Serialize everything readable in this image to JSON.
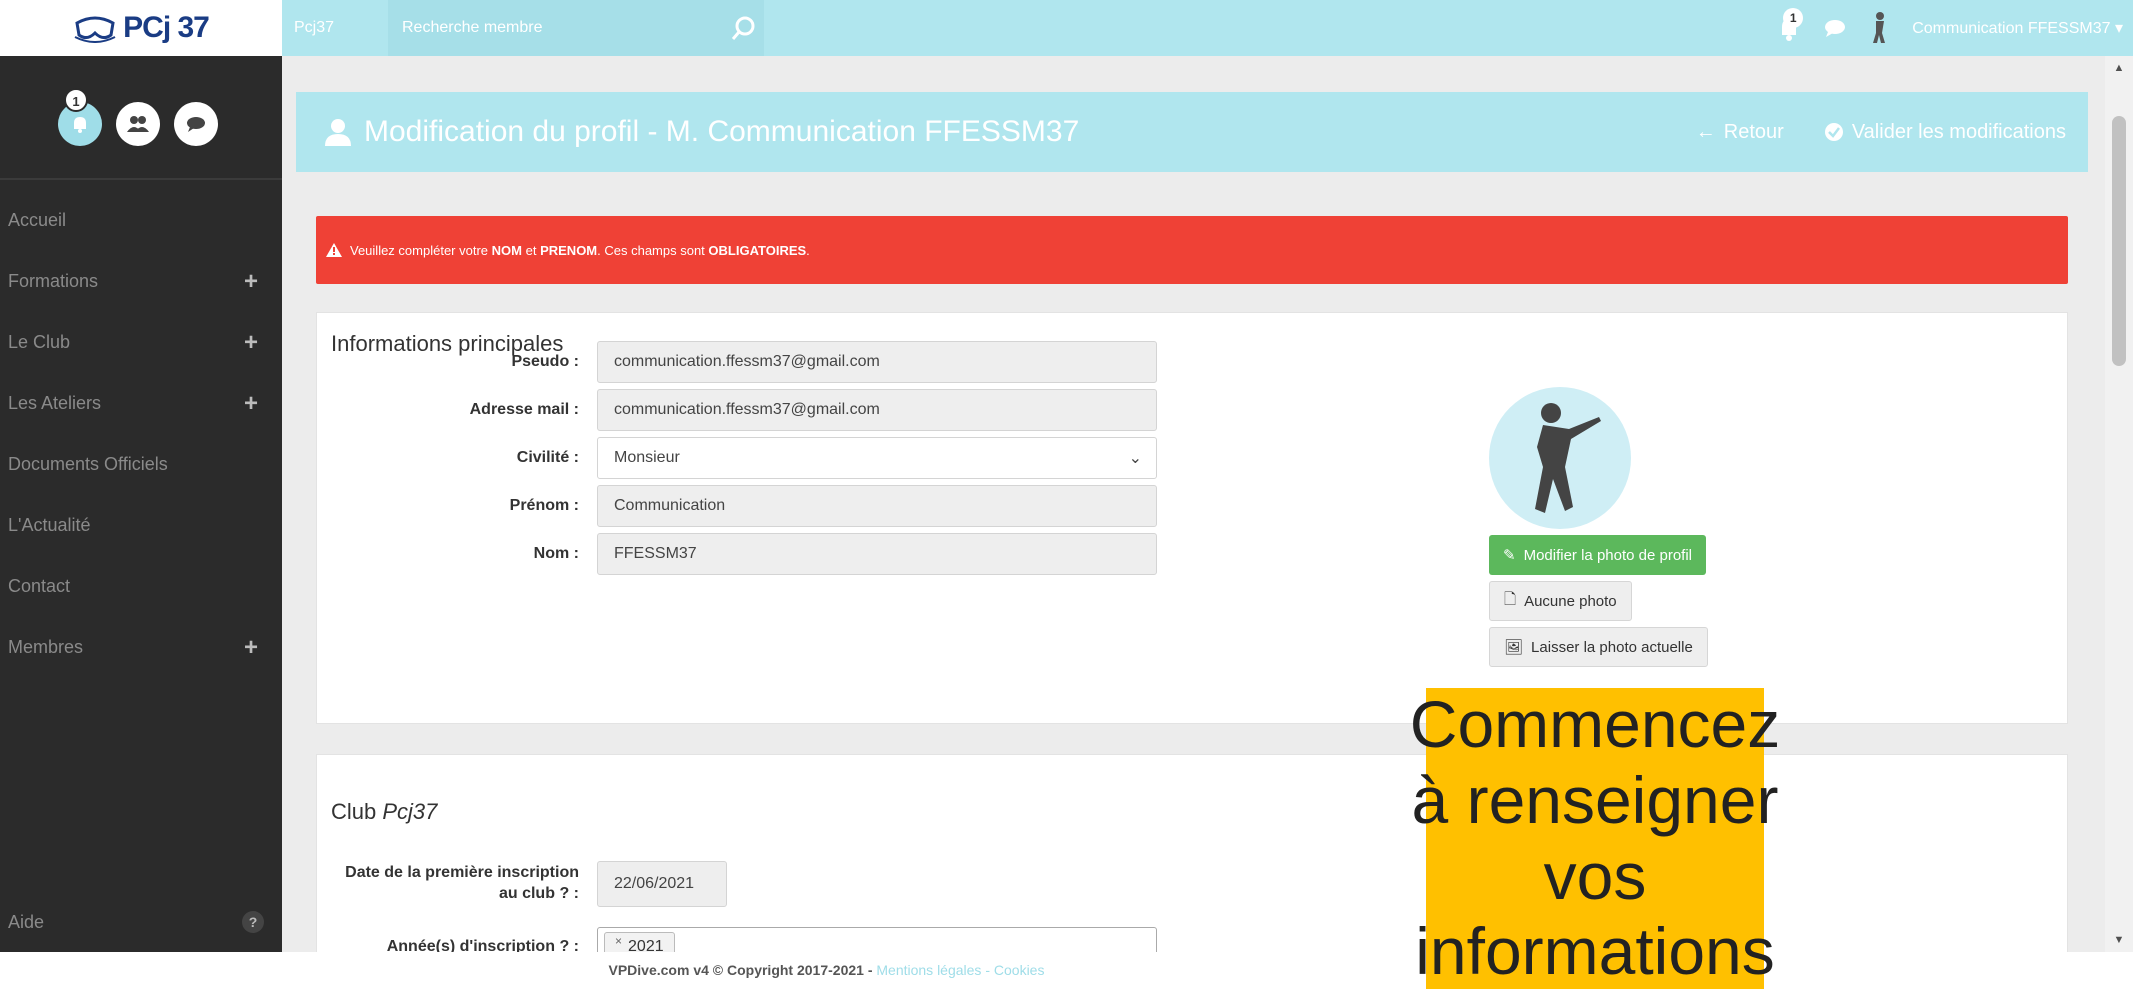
{
  "topbar": {
    "logo_text": "PCj 37",
    "brand": "Pcj37",
    "search_placeholder": "Recherche membre",
    "notif_count": "1",
    "user_name": "Communication FFESSM37"
  },
  "sidebar": {
    "notif_count": "1",
    "items": [
      {
        "label": "Accueil",
        "expandable": false
      },
      {
        "label": "Formations",
        "expandable": true
      },
      {
        "label": "Le Club",
        "expandable": true
      },
      {
        "label": "Les Ateliers",
        "expandable": true
      },
      {
        "label": "Documents Officiels",
        "expandable": false
      },
      {
        "label": "L'Actualité",
        "expandable": false
      },
      {
        "label": "Contact",
        "expandable": false
      },
      {
        "label": "Membres",
        "expandable": true
      }
    ],
    "help_label": "Aide"
  },
  "header": {
    "title": "Modification du profil - M. Communication FFESSM37",
    "back_label": "Retour",
    "validate_label": "Valider les modifications"
  },
  "alert": {
    "prefix": "Veuillez compléter votre",
    "nom": "NOM",
    "et": "et",
    "prenom": "PRENOM",
    "middle": ". Ces champs sont",
    "obligatoires": "OBLIGATOIRES",
    "suffix": "."
  },
  "main_info": {
    "section_title": "Informations principales",
    "pseudo_label": "Pseudo :",
    "pseudo_value": "communication.ffessm37@gmail.com",
    "email_label": "Adresse mail :",
    "email_value": "communication.ffessm37@gmail.com",
    "civilite_label": "Civilité :",
    "civilite_value": "Monsieur",
    "prenom_label": "Prénom :",
    "prenom_value": "Communication",
    "nom_label": "Nom :",
    "nom_value": "FFESSM37",
    "modify_photo": "Modifier la photo de profil",
    "no_photo": "Aucune photo",
    "keep_photo": "Laisser la photo actuelle"
  },
  "club": {
    "section_prefix": "Club",
    "club_name": "Pcj37",
    "first_reg_label_1": "Date de la première inscription",
    "first_reg_label_2": "au club",
    "first_reg_value": "22/06/2021",
    "years_label": "Année(s) d'inscription",
    "years_tags": [
      "2021"
    ]
  },
  "footer": {
    "text": "VPDive.com v4 © Copyright 2017-2021 -",
    "legal": "Mentions légales",
    "sep": "-",
    "cookies": "Cookies"
  },
  "callout": {
    "text": "Commencez à renseigner vos informations"
  },
  "colors": {
    "accent": "#b0e6ee",
    "sidebar": "#2b2b2b",
    "alert": "#ef4136",
    "success": "#5cb85c",
    "callout": "#ffc000"
  }
}
